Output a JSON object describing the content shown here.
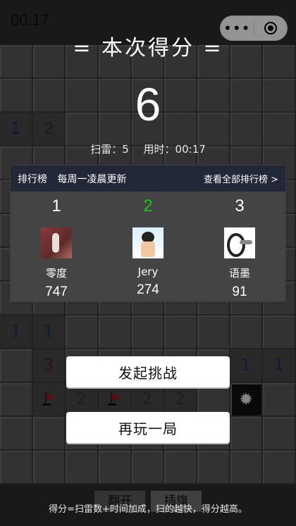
{
  "status_bar": {
    "time": "00:17"
  },
  "capsule": {
    "more_label": "•••",
    "close_icon": "target-icon"
  },
  "board": {
    "cells": [
      [
        "",
        "",
        "",
        "",
        "",
        "",
        "",
        "",
        ""
      ],
      [
        "",
        "",
        "",
        "",
        "",
        "",
        "",
        "",
        ""
      ],
      [
        "1",
        "2",
        "",
        "",
        "",
        "",
        "",
        "",
        ""
      ],
      [
        "",
        "",
        "",
        "",
        "",
        "",
        "",
        "",
        ""
      ],
      [
        "",
        "",
        "",
        "",
        "",
        "",
        "",
        "",
        ""
      ],
      [
        "",
        "",
        "",
        "",
        "",
        "",
        "",
        "",
        ""
      ],
      [
        "",
        "",
        "",
        "",
        "",
        "",
        "",
        "",
        ""
      ],
      [
        "",
        "",
        "",
        "",
        "",
        "",
        "",
        "",
        ""
      ],
      [
        "1",
        "1",
        "",
        "",
        "",
        "",
        "",
        "",
        ""
      ],
      [
        "",
        "3",
        "",
        "",
        "",
        "",
        "",
        "1",
        "1"
      ],
      [
        "",
        "F",
        "2",
        "F",
        "2",
        "2",
        "",
        "M",
        ""
      ],
      [
        "",
        "",
        "",
        "",
        "",
        "",
        "",
        "",
        ""
      ],
      [
        "",
        "",
        "",
        "",
        "",
        "",
        "",
        "",
        ""
      ]
    ]
  },
  "result": {
    "title": "= 本次得分 =",
    "score": "6",
    "mines_label": "扫雷：5",
    "time_label": "用时：00:17"
  },
  "leaderboard": {
    "title": "排行榜",
    "subtitle": "每周一凌晨更新",
    "view_all": "查看全部排行榜 >",
    "entries": [
      {
        "rank": "1",
        "name": "零度",
        "score": "747"
      },
      {
        "rank": "2",
        "name": "Jery",
        "score": "274"
      },
      {
        "rank": "3",
        "name": "语墨",
        "score": "91"
      }
    ]
  },
  "buttons": {
    "challenge": "发起挑战",
    "play_again": "再玩一局"
  },
  "modes": {
    "open": "翻开",
    "flag": "插旗"
  },
  "hint": "得分=扫雷数+时间加成，扫的越快，得分越高。",
  "colors": {
    "rank2": "#18c618",
    "header_bg": "#232838"
  }
}
